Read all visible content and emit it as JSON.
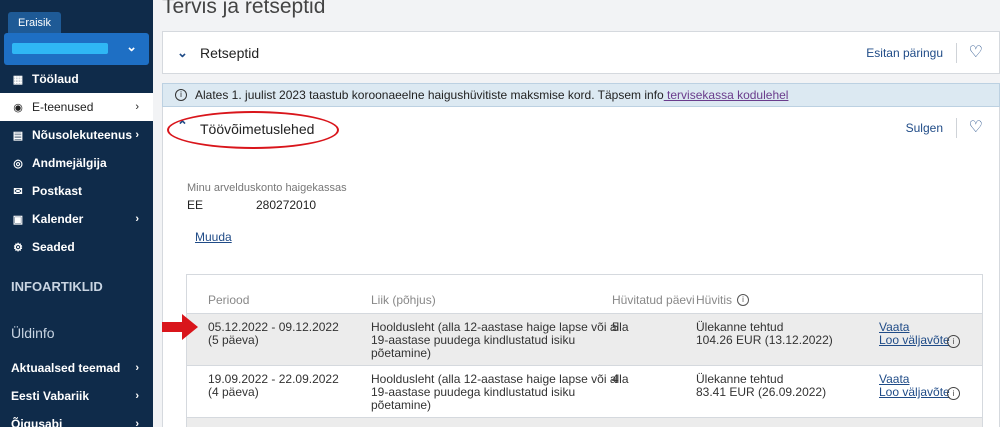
{
  "sidebar": {
    "role_tab": "Eraisik",
    "nav": [
      {
        "label": "Töölaud",
        "icon": "dashboard-icon"
      },
      {
        "label": "E-teenused",
        "icon": "user-circle-icon",
        "arrow": "›"
      },
      {
        "label": "Nõusolekuteenus",
        "icon": "consent-icon",
        "arrow": "›"
      },
      {
        "label": "Andmejälgija",
        "icon": "eye-icon"
      },
      {
        "label": "Postkast",
        "icon": "mail-icon"
      },
      {
        "label": "Kalender",
        "icon": "calendar-icon",
        "arrow": "›"
      },
      {
        "label": "Seaded",
        "icon": "gear-icon"
      }
    ],
    "section1": "INFOARTIKLID",
    "section2": "Üldinfo",
    "links": [
      {
        "label": "Aktuaalsed teemad",
        "arrow": "›"
      },
      {
        "label": "Eesti Vabariik",
        "arrow": "›"
      },
      {
        "label": "Õigusabi",
        "arrow": "›"
      }
    ]
  },
  "main": {
    "title": "Tervis ja retseptid",
    "prescriptions": {
      "title": "Retseptid",
      "action": "Esitan päringu"
    },
    "notice": {
      "text": "Alates 1. juulist 2023 taastub koroonaeelne haigushüvitiste maksmise kord. Täpsem info",
      "link": " tervisekassa kodulehel"
    },
    "certificates": {
      "title": "Töövõimetuslehed",
      "action": "Sulgen"
    },
    "account": {
      "label": "Minu arvelduskonto haigekassas",
      "prefix": "EE",
      "number": "280272010",
      "edit": "Muuda"
    },
    "table": {
      "headers": [
        "Periood",
        "Liik (põhjus)",
        "Hüvitatud päevi",
        "Hüvitis"
      ],
      "rows": [
        {
          "period": "05.12.2022 - 09.12.2022",
          "days_note": "(5 päeva)",
          "type_lines": [
            "Hooldusleht (alla 12-aastase haige lapse või alla",
            "19-aastase puudega kindlustatud isiku",
            "põetamine)"
          ],
          "days": "5",
          "status": "Ülekanne tehtud",
          "amount": "104.26 EUR (13.12.2022)",
          "view": "Vaata",
          "extract": "Loo väljavõte"
        },
        {
          "period": "19.09.2022 - 22.09.2022",
          "days_note": "(4 päeva)",
          "type_lines": [
            "Hooldusleht (alla 12-aastase haige lapse või alla",
            "19-aastase puudega kindlustatud isiku",
            "põetamine)"
          ],
          "days": "4",
          "status": "Ülekanne tehtud",
          "amount": "83.41 EUR (26.09.2022)",
          "view": "Vaata",
          "extract": "Loo väljavõte"
        }
      ]
    }
  },
  "colors": {
    "sidebar": "#0f2b4a",
    "accent": "#1e6fc4",
    "annotation": "#d9151b"
  }
}
